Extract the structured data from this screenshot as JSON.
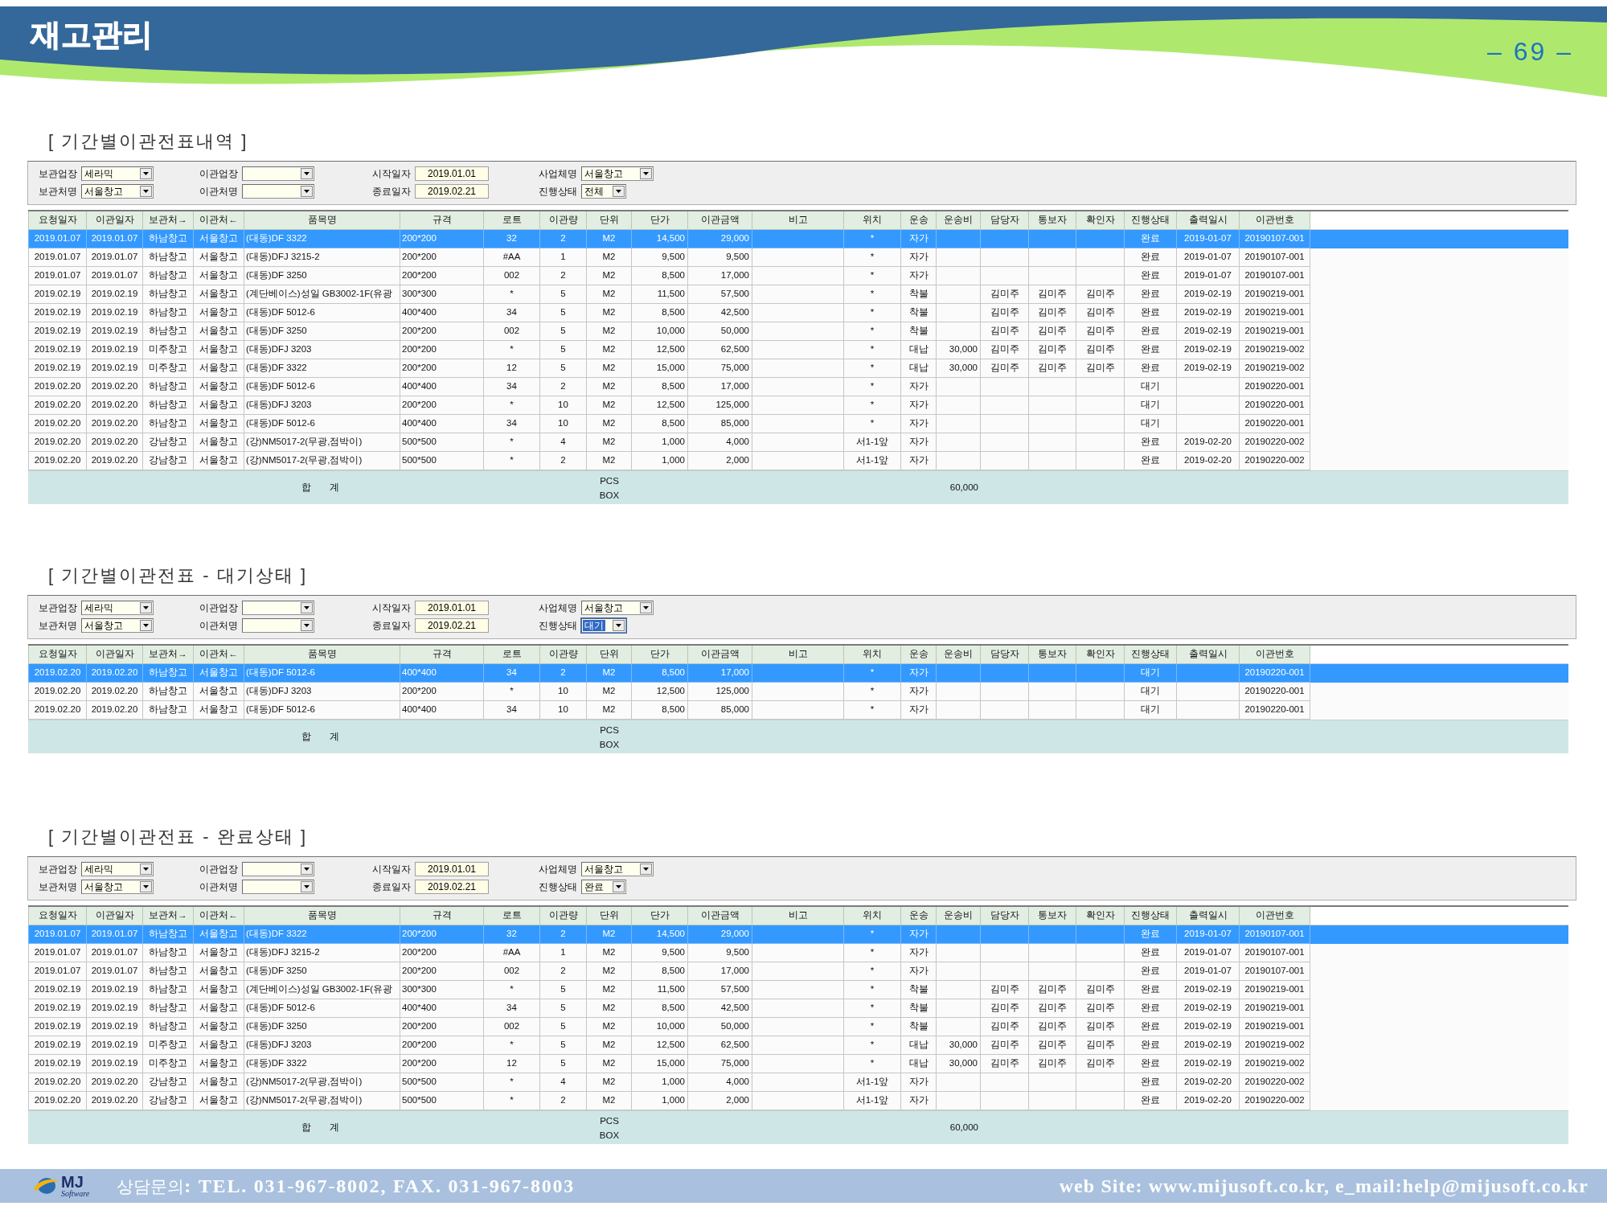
{
  "header": {
    "title": "재고관리",
    "page_number": "– 69 –"
  },
  "sections": [
    {
      "title": "[ 기간별이관전표내역 ]",
      "filter_rows": [
        [
          {
            "label": "보관업장",
            "value": "세라믹",
            "kind": "combo",
            "highlighted": false
          },
          {
            "label": "이관업장",
            "kind": "combo",
            "highlighted": false
          },
          {
            "label": "시작일자",
            "value": "2019.01.01",
            "kind": "date",
            "highlighted": false
          },
          {
            "label": "사업체명",
            "value": "서울창고",
            "kind": "combo",
            "highlighted": false
          }
        ],
        [
          {
            "label": "보관처명",
            "value": "서울창고",
            "kind": "combo",
            "highlighted": false
          },
          {
            "label": "이관처명",
            "kind": "combo",
            "highlighted": false
          },
          {
            "label": "종료일자",
            "value": "2019.02.21",
            "kind": "date",
            "highlighted": false
          },
          {
            "label": "진행상태",
            "value": "전체",
            "kind": "small_combo",
            "highlighted": false
          }
        ]
      ],
      "table": {
        "columns": [
          "요청일자",
          "이관일자",
          "보관처→",
          "이관처←",
          "품목명",
          "규격",
          "로트",
          "이관량",
          "단위",
          "단가",
          "이관금액",
          "비고",
          "위치",
          "운송",
          "운송비",
          "담당자",
          "통보자",
          "확인자",
          "진행상태",
          "출력일시",
          "이관번호"
        ],
        "rows": [
          {
            "selected": true,
            "request_date": "2019.01.07",
            "transfer_date": "2019.01.07",
            "source": "하남창고",
            "destination": "서울창고",
            "item": "(대동)DF 3322",
            "spec": "200*200",
            "lot": "32",
            "quantity": "2",
            "unit": "M2",
            "unit_price": "14,500",
            "amount": "29,000",
            "location": "*",
            "delivery": "자가",
            "status": "완료",
            "printed_at": "2019-01-07",
            "transfer_no": "20190107-001"
          },
          {
            "selected": false,
            "request_date": "2019.01.07",
            "transfer_date": "2019.01.07",
            "source": "하남창고",
            "destination": "서울창고",
            "item": "(대동)DFJ 3215-2",
            "spec": "200*200",
            "lot": "#AA",
            "quantity": "1",
            "unit": "M2",
            "unit_price": "9,500",
            "amount": "9,500",
            "location": "*",
            "delivery": "자가",
            "status": "완료",
            "printed_at": "2019-01-07",
            "transfer_no": "20190107-001"
          },
          {
            "selected": false,
            "request_date": "2019.01.07",
            "transfer_date": "2019.01.07",
            "source": "하남창고",
            "destination": "서울창고",
            "item": "(대동)DF 3250",
            "spec": "200*200",
            "lot": "002",
            "quantity": "2",
            "unit": "M2",
            "unit_price": "8,500",
            "amount": "17,000",
            "location": "*",
            "delivery": "자가",
            "status": "완료",
            "printed_at": "2019-01-07",
            "transfer_no": "20190107-001"
          },
          {
            "selected": false,
            "request_date": "2019.02.19",
            "transfer_date": "2019.02.19",
            "source": "하남창고",
            "destination": "서울창고",
            "item": "(계단베이스)성일 GB3002-1F(유광",
            "spec": "300*300",
            "lot": "*",
            "quantity": "5",
            "unit": "M2",
            "unit_price": "11,500",
            "amount": "57,500",
            "location": "*",
            "delivery": "착불",
            "manager": "김미주",
            "notifier": "김미주",
            "checker": "김미주",
            "status": "완료",
            "printed_at": "2019-02-19",
            "transfer_no": "20190219-001"
          },
          {
            "selected": false,
            "request_date": "2019.02.19",
            "transfer_date": "2019.02.19",
            "source": "하남창고",
            "destination": "서울창고",
            "item": "(대동)DF 5012-6",
            "spec": "400*400",
            "lot": "34",
            "quantity": "5",
            "unit": "M2",
            "unit_price": "8,500",
            "amount": "42,500",
            "location": "*",
            "delivery": "착불",
            "manager": "김미주",
            "notifier": "김미주",
            "checker": "김미주",
            "status": "완료",
            "printed_at": "2019-02-19",
            "transfer_no": "20190219-001"
          },
          {
            "selected": false,
            "request_date": "2019.02.19",
            "transfer_date": "2019.02.19",
            "source": "하남창고",
            "destination": "서울창고",
            "item": "(대동)DF 3250",
            "spec": "200*200",
            "lot": "002",
            "quantity": "5",
            "unit": "M2",
            "unit_price": "10,000",
            "amount": "50,000",
            "location": "*",
            "delivery": "착불",
            "manager": "김미주",
            "notifier": "김미주",
            "checker": "김미주",
            "status": "완료",
            "printed_at": "2019-02-19",
            "transfer_no": "20190219-001"
          },
          {
            "selected": false,
            "request_date": "2019.02.19",
            "transfer_date": "2019.02.19",
            "source": "미주창고",
            "destination": "서울창고",
            "item": "(대동)DFJ 3203",
            "spec": "200*200",
            "lot": "*",
            "quantity": "5",
            "unit": "M2",
            "unit_price": "12,500",
            "amount": "62,500",
            "location": "*",
            "delivery": "대납",
            "delivery_fee": "30,000",
            "manager": "김미주",
            "notifier": "김미주",
            "checker": "김미주",
            "status": "완료",
            "printed_at": "2019-02-19",
            "transfer_no": "20190219-002"
          },
          {
            "selected": false,
            "request_date": "2019.02.19",
            "transfer_date": "2019.02.19",
            "source": "미주창고",
            "destination": "서울창고",
            "item": "(대동)DF 3322",
            "spec": "200*200",
            "lot": "12",
            "quantity": "5",
            "unit": "M2",
            "unit_price": "15,000",
            "amount": "75,000",
            "location": "*",
            "delivery": "대납",
            "delivery_fee": "30,000",
            "manager": "김미주",
            "notifier": "김미주",
            "checker": "김미주",
            "status": "완료",
            "printed_at": "2019-02-19",
            "transfer_no": "20190219-002"
          },
          {
            "selected": false,
            "request_date": "2019.02.20",
            "transfer_date": "2019.02.20",
            "source": "하남창고",
            "destination": "서울창고",
            "item": "(대동)DF 5012-6",
            "spec": "400*400",
            "lot": "34",
            "quantity": "2",
            "unit": "M2",
            "unit_price": "8,500",
            "amount": "17,000",
            "location": "*",
            "delivery": "자가",
            "status": "대기",
            "transfer_no": "20190220-001"
          },
          {
            "selected": false,
            "request_date": "2019.02.20",
            "transfer_date": "2019.02.20",
            "source": "하남창고",
            "destination": "서울창고",
            "item": "(대동)DFJ 3203",
            "spec": "200*200",
            "lot": "*",
            "quantity": "10",
            "unit": "M2",
            "unit_price": "12,500",
            "amount": "125,000",
            "location": "*",
            "delivery": "자가",
            "status": "대기",
            "transfer_no": "20190220-001"
          },
          {
            "selected": false,
            "request_date": "2019.02.20",
            "transfer_date": "2019.02.20",
            "source": "하남창고",
            "destination": "서울창고",
            "item": "(대동)DF 5012-6",
            "spec": "400*400",
            "lot": "34",
            "quantity": "10",
            "unit": "M2",
            "unit_price": "8,500",
            "amount": "85,000",
            "location": "*",
            "delivery": "자가",
            "status": "대기",
            "transfer_no": "20190220-001"
          },
          {
            "selected": false,
            "request_date": "2019.02.20",
            "transfer_date": "2019.02.20",
            "source": "강남창고",
            "destination": "서울창고",
            "item": "(강)NM5017-2(무광,점박이)",
            "spec": "500*500",
            "lot": "*",
            "quantity": "4",
            "unit": "M2",
            "unit_price": "1,000",
            "amount": "4,000",
            "location": "서1-1앞",
            "delivery": "자가",
            "status": "완료",
            "printed_at": "2019-02-20",
            "transfer_no": "20190220-002"
          },
          {
            "selected": false,
            "request_date": "2019.02.20",
            "transfer_date": "2019.02.20",
            "source": "강남창고",
            "destination": "서울창고",
            "item": "(강)NM5017-2(무광,점박이)",
            "spec": "500*500",
            "lot": "*",
            "quantity": "2",
            "unit": "M2",
            "unit_price": "1,000",
            "amount": "2,000",
            "location": "서1-1앞",
            "delivery": "자가",
            "status": "완료",
            "printed_at": "2019-02-20",
            "transfer_no": "20190220-002"
          }
        ],
        "total": {
          "label": "합 계",
          "units": [
            "PCS",
            "BOX"
          ],
          "delivery_fee": "60,000"
        }
      }
    },
    {
      "title": "[ 기간별이관전표 - 대기상태 ]",
      "filter_rows": [
        [
          {
            "label": "보관업장",
            "value": "세라믹",
            "kind": "combo",
            "highlighted": false
          },
          {
            "label": "이관업장",
            "kind": "combo",
            "highlighted": false
          },
          {
            "label": "시작일자",
            "value": "2019.01.01",
            "kind": "date",
            "highlighted": false
          },
          {
            "label": "사업체명",
            "value": "서울창고",
            "kind": "combo",
            "highlighted": false
          }
        ],
        [
          {
            "label": "보관처명",
            "value": "서울창고",
            "kind": "combo",
            "highlighted": false
          },
          {
            "label": "이관처명",
            "kind": "combo",
            "highlighted": false
          },
          {
            "label": "종료일자",
            "value": "2019.02.21",
            "kind": "date",
            "highlighted": false
          },
          {
            "label": "진행상태",
            "value": "대기",
            "kind": "small_combo",
            "highlighted": true
          }
        ]
      ],
      "table": {
        "columns": [
          "요청일자",
          "이관일자",
          "보관처→",
          "이관처←",
          "품목명",
          "규격",
          "로트",
          "이관량",
          "단위",
          "단가",
          "이관금액",
          "비고",
          "위치",
          "운송",
          "운송비",
          "담당자",
          "통보자",
          "확인자",
          "진행상태",
          "출력일시",
          "이관번호"
        ],
        "rows": [
          {
            "selected": true,
            "request_date": "2019.02.20",
            "transfer_date": "2019.02.20",
            "source": "하남창고",
            "destination": "서울창고",
            "item": "(대동)DF 5012-6",
            "spec": "400*400",
            "lot": "34",
            "quantity": "2",
            "unit": "M2",
            "unit_price": "8,500",
            "amount": "17,000",
            "location": "*",
            "delivery": "자가",
            "status": "대기",
            "transfer_no": "20190220-001"
          },
          {
            "selected": false,
            "request_date": "2019.02.20",
            "transfer_date": "2019.02.20",
            "source": "하남창고",
            "destination": "서울창고",
            "item": "(대동)DFJ 3203",
            "spec": "200*200",
            "lot": "*",
            "quantity": "10",
            "unit": "M2",
            "unit_price": "12,500",
            "amount": "125,000",
            "location": "*",
            "delivery": "자가",
            "status": "대기",
            "transfer_no": "20190220-001"
          },
          {
            "selected": false,
            "request_date": "2019.02.20",
            "transfer_date": "2019.02.20",
            "source": "하남창고",
            "destination": "서울창고",
            "item": "(대동)DF 5012-6",
            "spec": "400*400",
            "lot": "34",
            "quantity": "10",
            "unit": "M2",
            "unit_price": "8,500",
            "amount": "85,000",
            "location": "*",
            "delivery": "자가",
            "status": "대기",
            "transfer_no": "20190220-001"
          }
        ],
        "total": {
          "label": "합 계",
          "units": [
            "PCS",
            "BOX"
          ]
        }
      }
    },
    {
      "title": "[ 기간별이관전표 - 완료상태 ]",
      "filter_rows": [
        [
          {
            "label": "보관업장",
            "value": "세라믹",
            "kind": "combo",
            "highlighted": false
          },
          {
            "label": "이관업장",
            "kind": "combo",
            "highlighted": false
          },
          {
            "label": "시작일자",
            "value": "2019.01.01",
            "kind": "date",
            "highlighted": false
          },
          {
            "label": "사업체명",
            "value": "서울창고",
            "kind": "combo",
            "highlighted": false
          }
        ],
        [
          {
            "label": "보관처명",
            "value": "서울창고",
            "kind": "combo",
            "highlighted": false
          },
          {
            "label": "이관처명",
            "kind": "combo",
            "highlighted": false
          },
          {
            "label": "종료일자",
            "value": "2019.02.21",
            "kind": "date",
            "highlighted": false
          },
          {
            "label": "진행상태",
            "value": "완료",
            "kind": "small_combo",
            "highlighted": false
          }
        ]
      ],
      "table": {
        "columns": [
          "요청일자",
          "이관일자",
          "보관처→",
          "이관처←",
          "품목명",
          "규격",
          "로트",
          "이관량",
          "단위",
          "단가",
          "이관금액",
          "비고",
          "위치",
          "운송",
          "운송비",
          "담당자",
          "통보자",
          "확인자",
          "진행상태",
          "출력일시",
          "이관번호"
        ],
        "rows": [
          {
            "selected": true,
            "request_date": "2019.01.07",
            "transfer_date": "2019.01.07",
            "source": "하남창고",
            "destination": "서울창고",
            "item": "(대동)DF 3322",
            "spec": "200*200",
            "lot": "32",
            "quantity": "2",
            "unit": "M2",
            "unit_price": "14,500",
            "amount": "29,000",
            "location": "*",
            "delivery": "자가",
            "status": "완료",
            "printed_at": "2019-01-07",
            "transfer_no": "20190107-001"
          },
          {
            "selected": false,
            "request_date": "2019.01.07",
            "transfer_date": "2019.01.07",
            "source": "하남창고",
            "destination": "서울창고",
            "item": "(대동)DFJ 3215-2",
            "spec": "200*200",
            "lot": "#AA",
            "quantity": "1",
            "unit": "M2",
            "unit_price": "9,500",
            "amount": "9,500",
            "location": "*",
            "delivery": "자가",
            "status": "완료",
            "printed_at": "2019-01-07",
            "transfer_no": "20190107-001"
          },
          {
            "selected": false,
            "request_date": "2019.01.07",
            "transfer_date": "2019.01.07",
            "source": "하남창고",
            "destination": "서울창고",
            "item": "(대동)DF 3250",
            "spec": "200*200",
            "lot": "002",
            "quantity": "2",
            "unit": "M2",
            "unit_price": "8,500",
            "amount": "17,000",
            "location": "*",
            "delivery": "자가",
            "status": "완료",
            "printed_at": "2019-01-07",
            "transfer_no": "20190107-001"
          },
          {
            "selected": false,
            "request_date": "2019.02.19",
            "transfer_date": "2019.02.19",
            "source": "하남창고",
            "destination": "서울창고",
            "item": "(계단베이스)성일 GB3002-1F(유광",
            "spec": "300*300",
            "lot": "*",
            "quantity": "5",
            "unit": "M2",
            "unit_price": "11,500",
            "amount": "57,500",
            "location": "*",
            "delivery": "착불",
            "manager": "김미주",
            "notifier": "김미주",
            "checker": "김미주",
            "status": "완료",
            "printed_at": "2019-02-19",
            "transfer_no": "20190219-001"
          },
          {
            "selected": false,
            "request_date": "2019.02.19",
            "transfer_date": "2019.02.19",
            "source": "하남창고",
            "destination": "서울창고",
            "item": "(대동)DF 5012-6",
            "spec": "400*400",
            "lot": "34",
            "quantity": "5",
            "unit": "M2",
            "unit_price": "8,500",
            "amount": "42,500",
            "location": "*",
            "delivery": "착불",
            "manager": "김미주",
            "notifier": "김미주",
            "checker": "김미주",
            "status": "완료",
            "printed_at": "2019-02-19",
            "transfer_no": "20190219-001"
          },
          {
            "selected": false,
            "request_date": "2019.02.19",
            "transfer_date": "2019.02.19",
            "source": "하남창고",
            "destination": "서울창고",
            "item": "(대동)DF 3250",
            "spec": "200*200",
            "lot": "002",
            "quantity": "5",
            "unit": "M2",
            "unit_price": "10,000",
            "amount": "50,000",
            "location": "*",
            "delivery": "착불",
            "manager": "김미주",
            "notifier": "김미주",
            "checker": "김미주",
            "status": "완료",
            "printed_at": "2019-02-19",
            "transfer_no": "20190219-001"
          },
          {
            "selected": false,
            "request_date": "2019.02.19",
            "transfer_date": "2019.02.19",
            "source": "미주창고",
            "destination": "서울창고",
            "item": "(대동)DFJ 3203",
            "spec": "200*200",
            "lot": "*",
            "quantity": "5",
            "unit": "M2",
            "unit_price": "12,500",
            "amount": "62,500",
            "location": "*",
            "delivery": "대납",
            "delivery_fee": "30,000",
            "manager": "김미주",
            "notifier": "김미주",
            "checker": "김미주",
            "status": "완료",
            "printed_at": "2019-02-19",
            "transfer_no": "20190219-002"
          },
          {
            "selected": false,
            "request_date": "2019.02.19",
            "transfer_date": "2019.02.19",
            "source": "미주창고",
            "destination": "서울창고",
            "item": "(대동)DF 3322",
            "spec": "200*200",
            "lot": "12",
            "quantity": "5",
            "unit": "M2",
            "unit_price": "15,000",
            "amount": "75,000",
            "location": "*",
            "delivery": "대납",
            "delivery_fee": "30,000",
            "manager": "김미주",
            "notifier": "김미주",
            "checker": "김미주",
            "status": "완료",
            "printed_at": "2019-02-19",
            "transfer_no": "20190219-002"
          },
          {
            "selected": false,
            "request_date": "2019.02.20",
            "transfer_date": "2019.02.20",
            "source": "강남창고",
            "destination": "서울창고",
            "item": "(강)NM5017-2(무광,점박이)",
            "spec": "500*500",
            "lot": "*",
            "quantity": "4",
            "unit": "M2",
            "unit_price": "1,000",
            "amount": "4,000",
            "location": "서1-1앞",
            "delivery": "자가",
            "status": "완료",
            "printed_at": "2019-02-20",
            "transfer_no": "20190220-002"
          },
          {
            "selected": false,
            "request_date": "2019.02.20",
            "transfer_date": "2019.02.20",
            "source": "강남창고",
            "destination": "서울창고",
            "item": "(강)NM5017-2(무광,점박이)",
            "spec": "500*500",
            "lot": "*",
            "quantity": "2",
            "unit": "M2",
            "unit_price": "1,000",
            "amount": "2,000",
            "location": "서1-1앞",
            "delivery": "자가",
            "status": "완료",
            "printed_at": "2019-02-20",
            "transfer_no": "20190220-002"
          }
        ],
        "total": {
          "label": "합 계",
          "units": [
            "PCS",
            "BOX"
          ],
          "delivery_fee": "60,000"
        }
      }
    }
  ],
  "footer": {
    "logo": {
      "name": "MJ",
      "tagline": "Software"
    },
    "contact": "상담문의**: TEL. 031-967-8002, FAX. 031-967-8003**",
    "website": "web Site: www.mijusoft.co.kr, e_mail:help@mijusoft.co.kr"
  }
}
